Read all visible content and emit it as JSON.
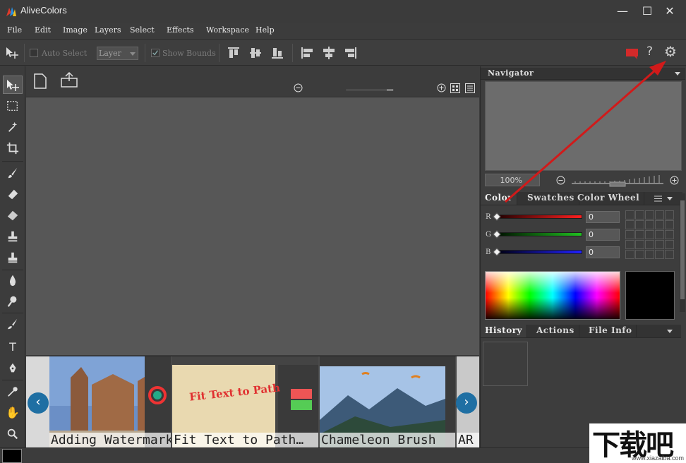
{
  "window": {
    "title": "AliveColors",
    "controls": {
      "minimize": "—",
      "maximize": "☐",
      "close": "✕"
    }
  },
  "menu": [
    "File",
    "Edit",
    "Image",
    "Layers",
    "Select",
    "Effects",
    "Workspace",
    "Help"
  ],
  "toolbar": {
    "auto_select_label": "Auto Select",
    "auto_select_checked": false,
    "layer_select_value": "Layer",
    "show_bounds_label": "Show Bounds",
    "show_bounds_checked": true,
    "right_icons": [
      "chat-icon",
      "help-icon",
      "settings-icon"
    ],
    "help_glyph": "?",
    "settings_glyph": "⚙"
  },
  "tools": [
    "move-tool-icon",
    "rect-select-icon",
    "magic-wand-icon",
    "crop-icon",
    "brush-icon",
    "eraser-icon",
    "gradient-icon",
    "stamp-icon",
    "healing-icon",
    "blur-icon",
    "sponge-icon",
    "smudge-icon",
    "text-icon",
    "pen-icon",
    "eyedropper-icon",
    "hand-icon",
    "zoom-icon"
  ],
  "tool_glyphs": {
    "text": "T",
    "hand": "✋",
    "zoom": "🔍"
  },
  "document_bar": {
    "icons": [
      "new-document-icon",
      "open-document-icon",
      "zoom-out-icon",
      "zoom-in-icon",
      "grid-view-icon",
      "list-view-icon"
    ]
  },
  "carousel": {
    "prev_glyph": "‹",
    "next_glyph": "›",
    "cards": [
      {
        "label": "Adding Watermarks"
      },
      {
        "label": "Fit Text to Path…",
        "thumb_text": "Fit Text to Path"
      },
      {
        "label": "Chameleon Brush"
      },
      {
        "label": "AR"
      }
    ]
  },
  "panels": {
    "navigator": {
      "title": "Navigator",
      "zoom_value": "100%"
    },
    "color": {
      "tabs": [
        "Color",
        "Swatches",
        "Color Wheel"
      ],
      "active_tab": "Color",
      "channels": [
        {
          "label": "R",
          "value": "0"
        },
        {
          "label": "G",
          "value": "0"
        },
        {
          "label": "B",
          "value": "0"
        }
      ],
      "current_color": "#000000"
    },
    "history": {
      "tabs": [
        "History",
        "Actions",
        "File Info"
      ],
      "active_tab": "History"
    }
  },
  "watermark": {
    "big": "下载吧",
    "small": "www.xiazaiba.com"
  },
  "colors": {
    "accent_blue": "#1f6fa3",
    "annotation_red": "#d11a1a",
    "chat_red": "#d42a2a"
  }
}
